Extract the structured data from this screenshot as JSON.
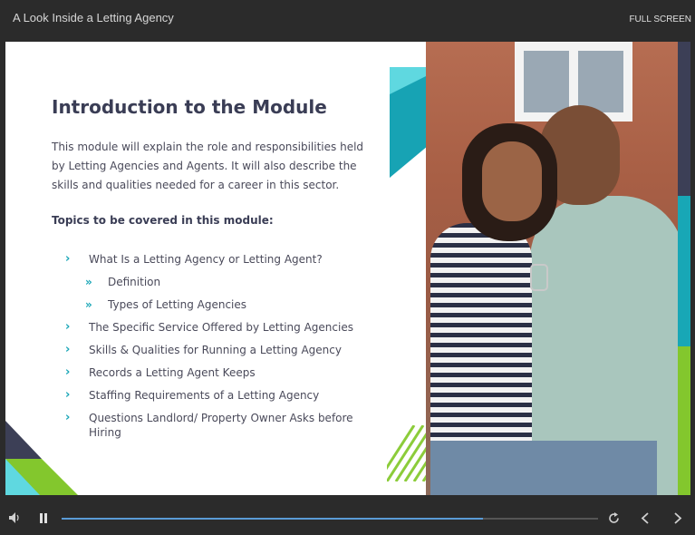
{
  "header": {
    "course_title": "A Look Inside a Letting Agency",
    "fullscreen_label": "FULL SCREEN"
  },
  "slide": {
    "title": "Introduction to the Module",
    "intro": "This module will explain the role and responsibilities held by Letting Agencies and Agents. It will also describe the skills and qualities needed for a career in this sector.",
    "topics_heading": "Topics to be covered in this module:",
    "agenda": [
      {
        "label": "What Is a Letting Agency or Letting Agent?",
        "level": 1
      },
      {
        "label": "Definition",
        "level": 2
      },
      {
        "label": "Types of Letting Agencies",
        "level": 2
      },
      {
        "label": "The Specific Service Offered by Letting Agencies",
        "level": 1
      },
      {
        "label": "Skills & Qualities for Running a Letting Agency",
        "level": 1
      },
      {
        "label": "Records a Letting Agent Keeps",
        "level": 1
      },
      {
        "label": "Staffing Requirements of a Letting Agency",
        "level": 1
      },
      {
        "label": "Questions Landlord/ Property Owner Asks before Hiring",
        "level": 1
      }
    ]
  },
  "player": {
    "progress_fraction": 0.785
  },
  "icons": {
    "volume": "volume-icon",
    "pause": "pause-icon",
    "replay": "replay-icon",
    "prev": "chevron-left-icon",
    "next": "chevron-right-icon",
    "bullet": "chevron-right-icon",
    "sub_bullet": "double-chevron-right-icon"
  },
  "colors": {
    "accent_teal": "#1aa6b7",
    "accent_green": "#83c72d",
    "navy": "#3c3f56",
    "progress": "#5a9bd6"
  }
}
